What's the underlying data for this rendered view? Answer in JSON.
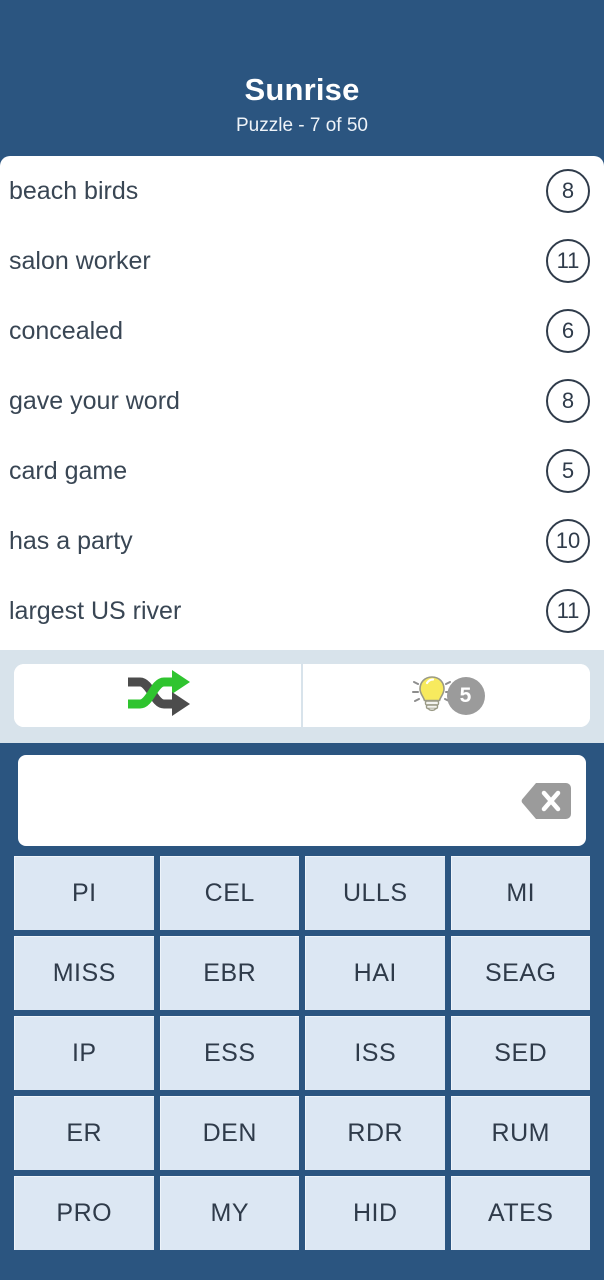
{
  "header": {
    "title": "Sunrise",
    "subtitle": "Puzzle - 7 of 50",
    "background_color": "#2b5580",
    "title_color": "#ffffff"
  },
  "clues": [
    {
      "text": "beach birds",
      "length": "8"
    },
    {
      "text": "salon worker",
      "length": "11"
    },
    {
      "text": "concealed",
      "length": "6"
    },
    {
      "text": "gave your word",
      "length": "8"
    },
    {
      "text": "card game",
      "length": "5"
    },
    {
      "text": "has a party",
      "length": "10"
    },
    {
      "text": "largest US river",
      "length": "11"
    }
  ],
  "toolbar": {
    "shuffle_icon": "shuffle-icon",
    "shuffle_label": "",
    "hint_icon": "lightbulb-icon",
    "hint_count": "5",
    "hint_badge_color": "#9b9b9b",
    "bulb_color": "#f7ea5e",
    "shuffle_green": "#2fc42f",
    "shuffle_gray": "#4c4c4c"
  },
  "answer": {
    "value": "",
    "placeholder": "",
    "backspace_icon": "backspace-icon",
    "backspace_label": "X"
  },
  "grid": {
    "rows": [
      [
        "PI",
        "CEL",
        "ULLS",
        "MI"
      ],
      [
        "MISS",
        "EBR",
        "HAI",
        "SEAG"
      ],
      [
        "IP",
        "ESS",
        "ISS",
        "SED"
      ],
      [
        "ER",
        "DEN",
        "RDR",
        "RUM"
      ],
      [
        "PRO",
        "MY",
        "HID",
        "ATES"
      ]
    ],
    "tile_color": "#dce7f3",
    "tile_text_color": "#2f3b4a"
  }
}
